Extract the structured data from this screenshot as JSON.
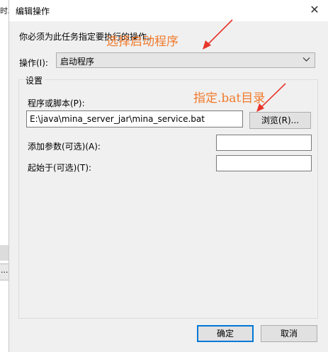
{
  "background_window": {
    "fragment_text": "时。",
    "bottom_button_text": "..."
  },
  "dialog": {
    "title": "编辑操作",
    "hint": "你必须为此任务指定要执行的操作。",
    "action_label": "操作(I):",
    "action_value": "启动程序",
    "settings_legend": "设置",
    "program_label": "程序或脚本(P):",
    "program_value": "E:\\java\\mina_server_jar\\mina_service.bat",
    "browse_label": "浏览(R)...",
    "args_label": "添加参数(可选)(A):",
    "args_value": "",
    "start_in_label": "起始于(可选)(T):",
    "start_in_value": "",
    "ok_label": "确定",
    "cancel_label": "取消"
  },
  "annotations": {
    "select_program": "选择启动程序",
    "bat_directory": "指定.bat目录"
  },
  "colors": {
    "annotation": "#f07a2c",
    "arrow": "#e8352a",
    "focus": "#0078d7"
  }
}
